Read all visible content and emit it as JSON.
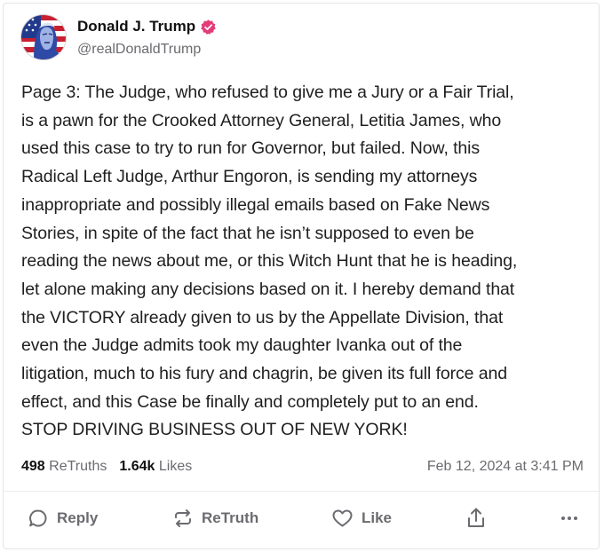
{
  "post": {
    "author_name": "Donald J. Trump",
    "handle": "@realDonaldTrump",
    "verified": true,
    "text": "Page 3: The Judge, who refused to give me a Jury or a Fair Trial,\nis a pawn for the Crooked Attorney General, Letitia James, who\nused this case to try to run for Governor, but failed. Now, this\nRadical Left Judge, Arthur Engoron, is sending my attorneys\ninappropriate and possibly illegal emails based on Fake News\nStories, in spite of the fact that he isn’t supposed to even be\nreading the news about me, or this Witch Hunt that he is heading,\nlet alone making any decisions based on it. I hereby demand that\nthe VICTORY already given to us by the Appellate Division, that\neven the Judge admits took my daughter Ivanka out of the\nlitigation, much to his fury and chagrin, be given its full force and\neffect, and this Case be finally and completely put to an end.\nSTOP DRIVING BUSINESS OUT OF NEW YORK!",
    "retruths_count": "498",
    "retruths_label": "ReTruths",
    "likes_count": "1.64k",
    "likes_label": "Likes",
    "timestamp": "Feb 12, 2024 at 3:41 PM"
  },
  "actions": {
    "reply": "Reply",
    "retruth": "ReTruth",
    "like": "Like",
    "share_icon": "share-icon",
    "more_icon": "more-icon"
  },
  "colors": {
    "verified_badge": "#E33C78",
    "muted_text": "#6B6B70",
    "body_text": "#1F1F1F"
  }
}
